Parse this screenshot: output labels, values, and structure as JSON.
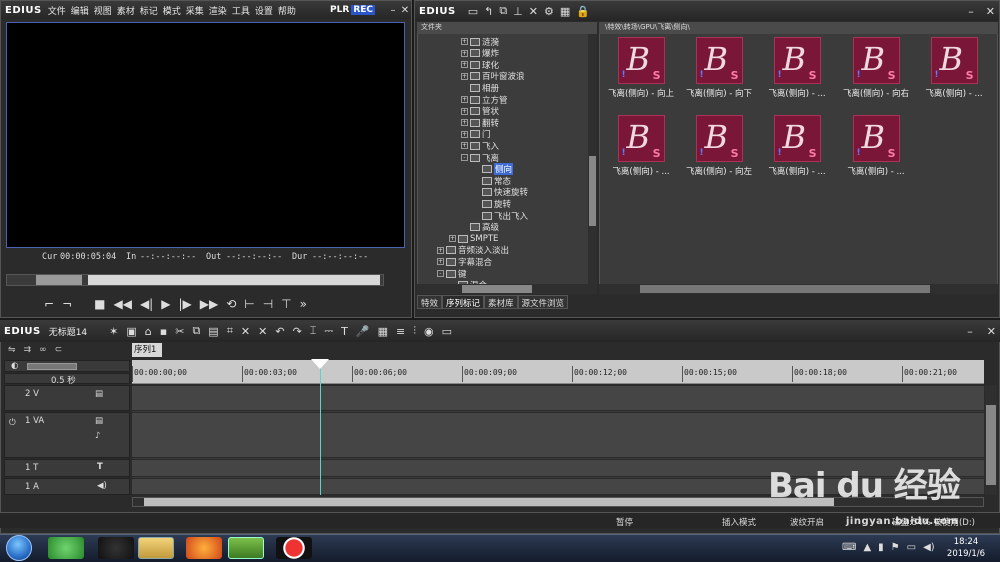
{
  "preview": {
    "brand": "EDIUS",
    "menu": [
      "文件",
      "编辑",
      "视图",
      "素材",
      "标记",
      "模式",
      "采集",
      "渲染",
      "工具",
      "设置",
      "帮助"
    ],
    "plr": "PLR",
    "rec": "REC",
    "timecodes": {
      "cur_label": "Cur",
      "cur": "00:00:05:04",
      "in_label": "In",
      "in": "--:--:--:--",
      "out_label": "Out",
      "out": "--:--:--:--",
      "dur_label": "Dur",
      "dur": "--:--:--:--"
    }
  },
  "bin": {
    "brand": "EDIUS",
    "folder_header": "文件夹",
    "path": "\\特效\\转场\\GPU\\飞离\\侧向\\",
    "tree": [
      {
        "label": "涟漪",
        "indent": 1,
        "expand": "+"
      },
      {
        "label": "爆炸",
        "indent": 1,
        "expand": "+"
      },
      {
        "label": "球化",
        "indent": 1,
        "expand": "+"
      },
      {
        "label": "百叶窗波浪",
        "indent": 1,
        "expand": "+"
      },
      {
        "label": "相册",
        "indent": 1,
        "expand": ""
      },
      {
        "label": "立方管",
        "indent": 1,
        "expand": "+"
      },
      {
        "label": "管状",
        "indent": 1,
        "expand": "+"
      },
      {
        "label": "翻转",
        "indent": 1,
        "expand": "+"
      },
      {
        "label": "门",
        "indent": 1,
        "expand": "+"
      },
      {
        "label": "飞入",
        "indent": 1,
        "expand": "+"
      },
      {
        "label": "飞离",
        "indent": 1,
        "expand": "-"
      },
      {
        "label": "侧向",
        "indent": 2,
        "expand": "",
        "selected": true
      },
      {
        "label": "常态",
        "indent": 2,
        "expand": ""
      },
      {
        "label": "快速旋转",
        "indent": 2,
        "expand": ""
      },
      {
        "label": "旋转",
        "indent": 2,
        "expand": ""
      },
      {
        "label": "飞出飞入",
        "indent": 2,
        "expand": ""
      },
      {
        "label": "高级",
        "indent": 1,
        "expand": ""
      },
      {
        "label": "SMPTE",
        "indent": 0,
        "expand": "+"
      },
      {
        "label": "音频淡入淡出",
        "indent": -1,
        "expand": "+"
      },
      {
        "label": "字幕混合",
        "indent": -1,
        "expand": "+"
      },
      {
        "label": "键",
        "indent": -1,
        "expand": "-"
      },
      {
        "label": "混合",
        "indent": 0,
        "expand": ""
      }
    ],
    "tabs": [
      "特效",
      "序列标记",
      "素材库",
      "源文件浏览"
    ],
    "clips": [
      "飞离(侧向) - 向上",
      "飞离(侧向) - 向下",
      "飞离(侧向) - ...",
      "飞离(侧向) - 向右",
      "飞离(侧向) - ...",
      "飞离(侧向) - ...",
      "飞离(侧向) - 向左",
      "飞离(侧向) - ...",
      "飞离(侧向) - ..."
    ]
  },
  "timeline": {
    "brand": "EDIUS",
    "project": "无标题14",
    "sequence_tab": "序列1",
    "zoom": "0.5 秒",
    "ruler": [
      "00:00:00;00",
      "00:00:03;00",
      "00:00:06;00",
      "00:00:09;00",
      "00:00:12;00",
      "00:00:15;00",
      "00:00:18;00",
      "00:00:21;00"
    ],
    "tracks": [
      {
        "name": "2 V"
      },
      {
        "name": "1 VA"
      },
      {
        "name": "1 T"
      },
      {
        "name": "1 A"
      }
    ],
    "status": {
      "state": "暂停",
      "mode": "插入模式",
      "ripple": "波纹开启",
      "disk": "磁盘:54% 被使用(D:)"
    }
  },
  "taskbar": {
    "time": "18:24",
    "date": "2019/1/6"
  },
  "watermark": {
    "main": "Bai du 经验",
    "sub": "jingyan.baidu.com"
  }
}
